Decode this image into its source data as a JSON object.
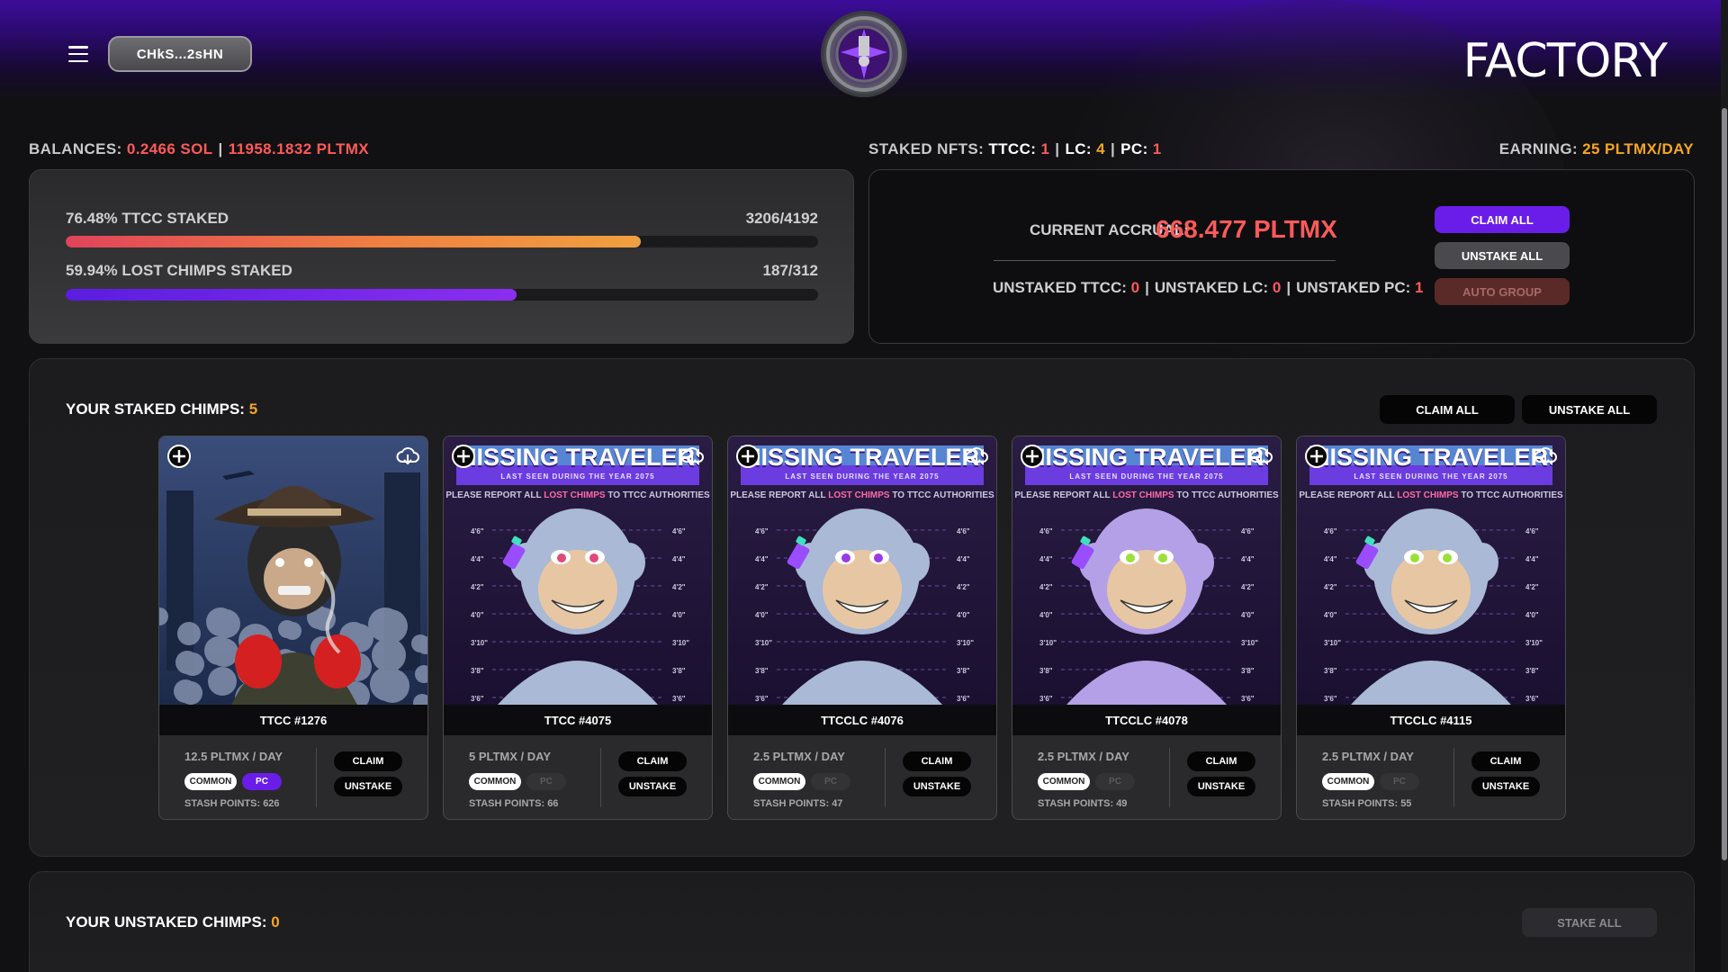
{
  "header": {
    "wallet_label": "CHkS...2sHN",
    "brand": "FACTORY"
  },
  "status": {
    "balances_label": "BALANCES:",
    "sol": "0.2466 SOL",
    "pltmx": "11958.1832 PLTMX",
    "staked_label": "STAKED NFTS:",
    "ttcc_label": "TTCC:",
    "ttcc": "1",
    "lc_label": "LC:",
    "lc": "4",
    "pc_label": "PC:",
    "pc": "1",
    "earning_label": "EARNING:",
    "earning": "25 PLTMX/DAY"
  },
  "progress": [
    {
      "label": "76.48% TTCC STAKED",
      "count": "3206/4192",
      "percent": 76.48
    },
    {
      "label": "59.94% LOST CHIMPS STAKED",
      "count": "187/312",
      "percent": 59.94
    }
  ],
  "accrual": {
    "label": "CURRENT ACCRUAL:",
    "value": "668.477 PLTMX",
    "unstaked_ttcc_label": "UNSTAKED TTCC:",
    "unstaked_ttcc": "0",
    "unstaked_lc_label": "UNSTAKED LC:",
    "unstaked_lc": "0",
    "unstaked_pc_label": "UNSTAKED PC:",
    "unstaked_pc": "1",
    "claim_all": "CLAIM ALL",
    "unstake_all": "UNSTAKE ALL",
    "auto_group": "AUTO GROUP"
  },
  "staked": {
    "title": "YOUR STAKED CHIMPS:",
    "count": "5",
    "claim_all": "CLAIM ALL",
    "unstake_all": "UNSTAKE ALL",
    "poster_title": "MISSING TRAVELERS",
    "poster_sub": "LAST SEEN DURING THE YEAR 2075",
    "poster_report_pre": "PLEASE REPORT ALL ",
    "poster_report_hl": "LOST CHIMPS",
    "poster_report_post": " TO TTCC AUTHORITIES",
    "heights_left": [
      "4'6\"",
      "4'4\"",
      "4'2\"",
      "4'0\"",
      "3'10\"",
      "3'8\"",
      "3'6\""
    ],
    "heights_right": [
      "4'6\"",
      "4'4\"",
      "4'2\"",
      "4'0\"",
      "3'10\"",
      "3'8\"",
      "3'6\""
    ],
    "cards": [
      {
        "name": "TTCC #1276",
        "rate": "12.5 PLTMX / DAY",
        "rarity": "COMMON",
        "pc": "PC",
        "pc_active": true,
        "stash": "STASH POINTS: 626",
        "claim": "CLAIM",
        "unstake": "UNSTAKE",
        "kind": "ttcc",
        "eye_color": "#ffffff",
        "fur": "#2a2a2a"
      },
      {
        "name": "TTCC #4075",
        "rate": "5 PLTMX / DAY",
        "rarity": "COMMON",
        "pc": "PC",
        "pc_active": false,
        "stash": "STASH POINTS: 66",
        "claim": "CLAIM",
        "unstake": "UNSTAKE",
        "kind": "poster",
        "eye_color": "#e04a7a",
        "fur": "#a9b9d6"
      },
      {
        "name": "TTCCLC #4076",
        "rate": "2.5 PLTMX / DAY",
        "rarity": "COMMON",
        "pc": "PC",
        "pc_active": false,
        "stash": "STASH POINTS: 47",
        "claim": "CLAIM",
        "unstake": "UNSTAKE",
        "kind": "poster",
        "eye_color": "#9a3ae8",
        "fur": "#a9b9d6"
      },
      {
        "name": "TTCCLC #4078",
        "rate": "2.5 PLTMX / DAY",
        "rarity": "COMMON",
        "pc": "PC",
        "pc_active": false,
        "stash": "STASH POINTS: 49",
        "claim": "CLAIM",
        "unstake": "UNSTAKE",
        "kind": "poster",
        "eye_color": "#9be03a",
        "fur": "#b3a0e6"
      },
      {
        "name": "TTCCLC #4115",
        "rate": "2.5 PLTMX / DAY",
        "rarity": "COMMON",
        "pc": "PC",
        "pc_active": false,
        "stash": "STASH POINTS: 55",
        "claim": "CLAIM",
        "unstake": "UNSTAKE",
        "kind": "poster",
        "eye_color": "#9be03a",
        "fur": "#a9b9d6"
      }
    ]
  },
  "unstaked": {
    "title": "YOUR UNSTAKED CHIMPS:",
    "count": "0",
    "stake_all": "STAKE ALL"
  },
  "colors": {
    "accent_purple": "#6a1de8",
    "red": "#ff5a5a",
    "orange": "#f5a524"
  }
}
